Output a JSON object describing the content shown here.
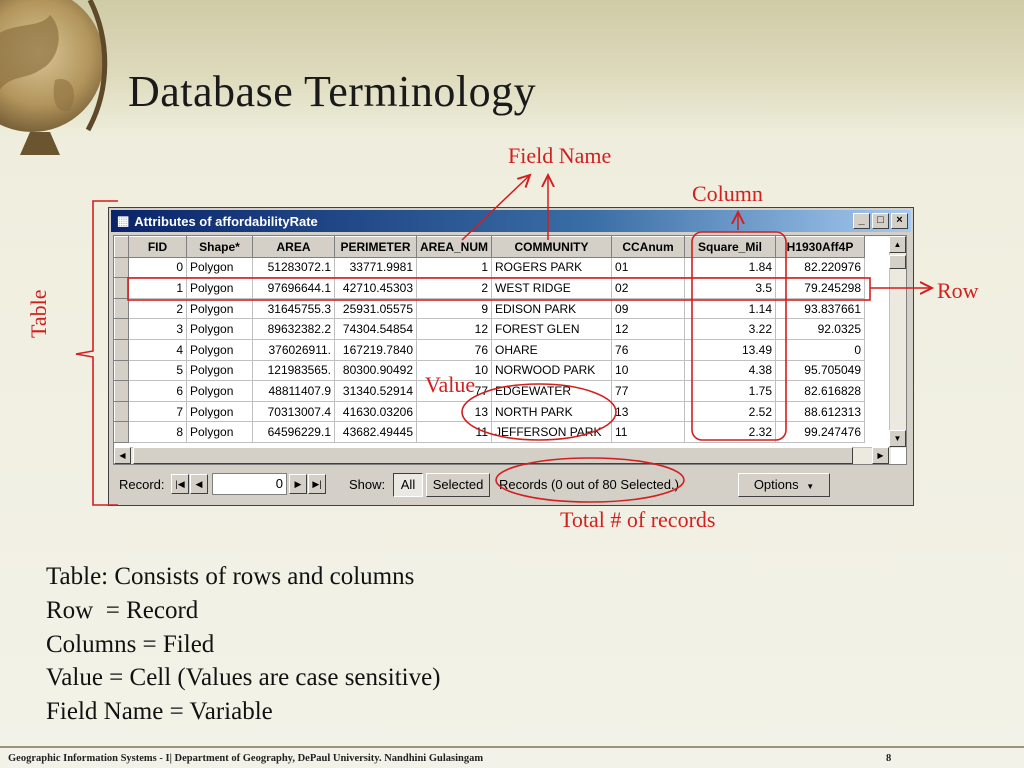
{
  "slide": {
    "title": "Database Terminology",
    "bullets": [
      "Table: Consists of rows and columns",
      "Row  = Record",
      "Columns = Filed",
      "Value = Cell (Values are case sensitive)",
      "Field Name = Variable"
    ],
    "footer": "Geographic Information Systems - I| Department of Geography, DePaul University. Nandhini Gulasingam",
    "page_number": "8"
  },
  "annotations": {
    "field_name": "Field Name",
    "column": "Column",
    "row": "Row",
    "table": "Table",
    "value": "Value",
    "total_records": "Total # of records",
    "color": "#d21f1f"
  },
  "window": {
    "title": "Attributes of affordabilityRate",
    "title_icon": "table-icon",
    "controls": [
      "minimize-icon",
      "maximize-icon",
      "close-icon"
    ],
    "columns": [
      "FID",
      "Shape*",
      "AREA",
      "PERIMETER",
      "AREA_NUM",
      "COMMUNITY",
      "CCAnum",
      "Square_Mil",
      "H1930Aff4P"
    ],
    "rows": [
      [
        "0",
        "Polygon",
        "51283072.1",
        "33771.9981",
        "1",
        "ROGERS PARK",
        "01",
        "1.84",
        "82.220976"
      ],
      [
        "1",
        "Polygon",
        "97696644.1",
        "42710.45303",
        "2",
        "WEST RIDGE",
        "02",
        "3.5",
        "79.245298"
      ],
      [
        "2",
        "Polygon",
        "31645755.3",
        "25931.05575",
        "9",
        "EDISON PARK",
        "09",
        "1.14",
        "93.837661"
      ],
      [
        "3",
        "Polygon",
        "89632382.2",
        "74304.54854",
        "12",
        "FOREST GLEN",
        "12",
        "3.22",
        "92.0325"
      ],
      [
        "4",
        "Polygon",
        "376026911.",
        "167219.7840",
        "76",
        "OHARE",
        "76",
        "13.49",
        "0"
      ],
      [
        "5",
        "Polygon",
        "121983565.",
        "80300.90492",
        "10",
        "NORWOOD PARK",
        "10",
        "4.38",
        "95.705049"
      ],
      [
        "6",
        "Polygon",
        "48811407.9",
        "31340.52914",
        "77",
        "EDGEWATER",
        "77",
        "1.75",
        "82.616828"
      ],
      [
        "7",
        "Polygon",
        "70313007.4",
        "41630.03206",
        "13",
        "NORTH PARK",
        "13",
        "2.52",
        "88.612313"
      ],
      [
        "8",
        "Polygon",
        "64596229.1",
        "43682.49445",
        "11",
        "JEFFERSON PARK",
        "11",
        "2.32",
        "99.247476"
      ]
    ],
    "statusbar": {
      "record_label": "Record:",
      "record_value": "0",
      "show_label": "Show:",
      "all_button": "All",
      "selected_button": "Selected",
      "records_text": "Records  (0 out of 80 Selected.)",
      "options_button": "Options"
    }
  }
}
